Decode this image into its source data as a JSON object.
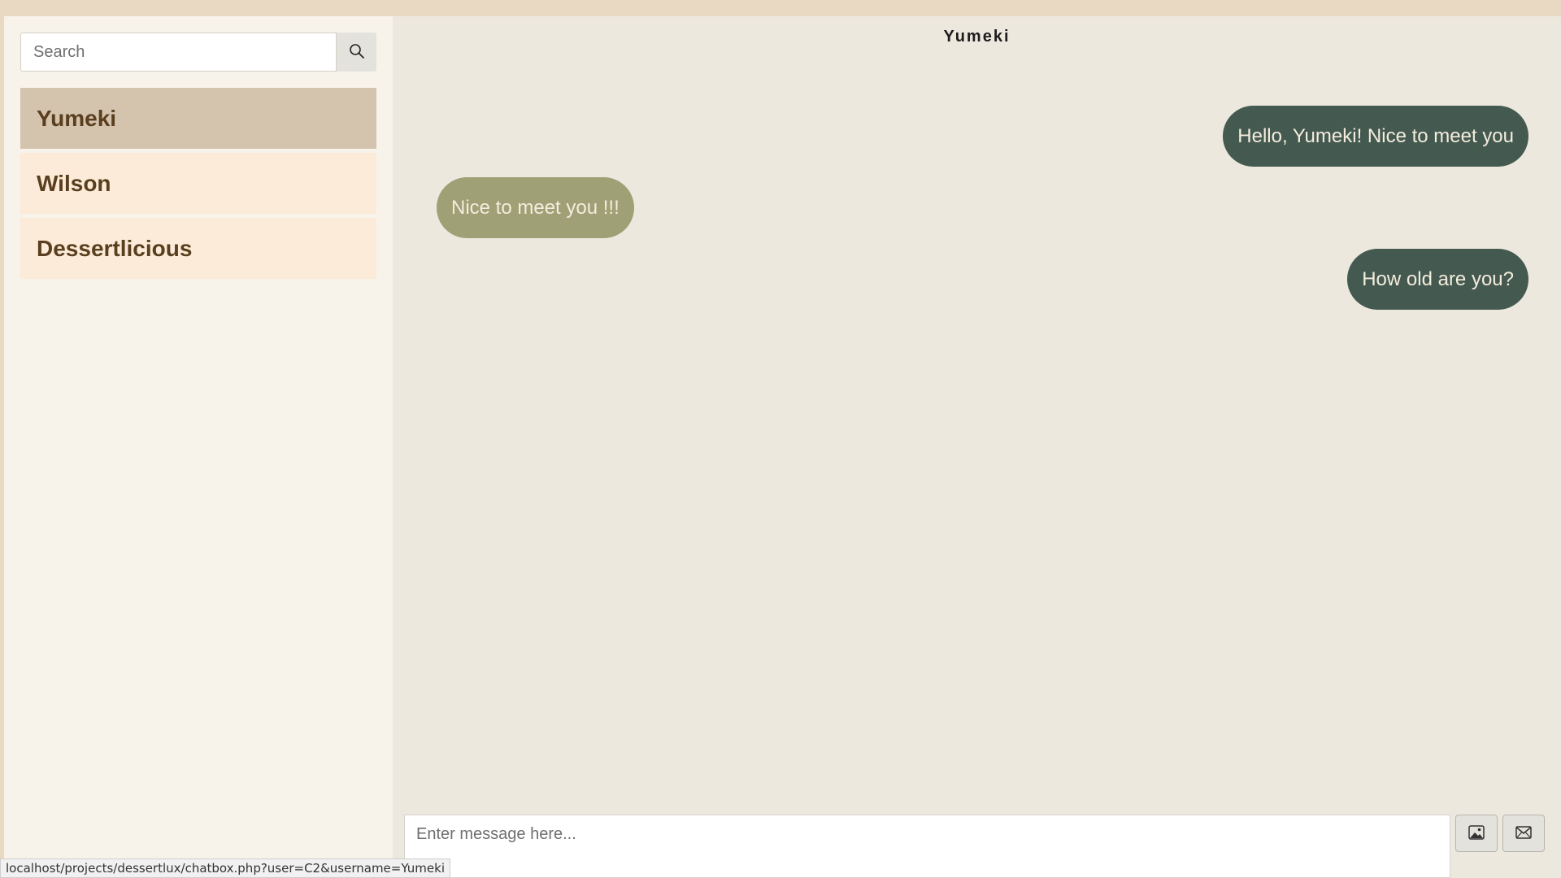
{
  "sidebar": {
    "search": {
      "placeholder": "Search"
    },
    "contacts": [
      {
        "name": "Yumeki",
        "active": true
      },
      {
        "name": "Wilson",
        "active": false
      },
      {
        "name": "Dessertlicious",
        "active": false
      }
    ]
  },
  "chat": {
    "title": "Yumeki",
    "messages": [
      {
        "text": "Hello, Yumeki! Nice to meet you",
        "direction": "sent"
      },
      {
        "text": "Nice to meet you !!!",
        "direction": "received"
      },
      {
        "text": "How old are you?",
        "direction": "sent"
      }
    ],
    "composer": {
      "placeholder": "Enter message here...",
      "image_icon": "image-icon",
      "send_icon": "envelope-icon"
    }
  },
  "status_bar": {
    "url": "localhost/projects/dessertlux/chatbox.php?user=C2&username=Yumeki"
  },
  "colors": {
    "sent_bubble": "#445a51",
    "received_bubble": "#9fa076",
    "active_contact": "#d4c3ad",
    "contact": "#fbebd8"
  }
}
